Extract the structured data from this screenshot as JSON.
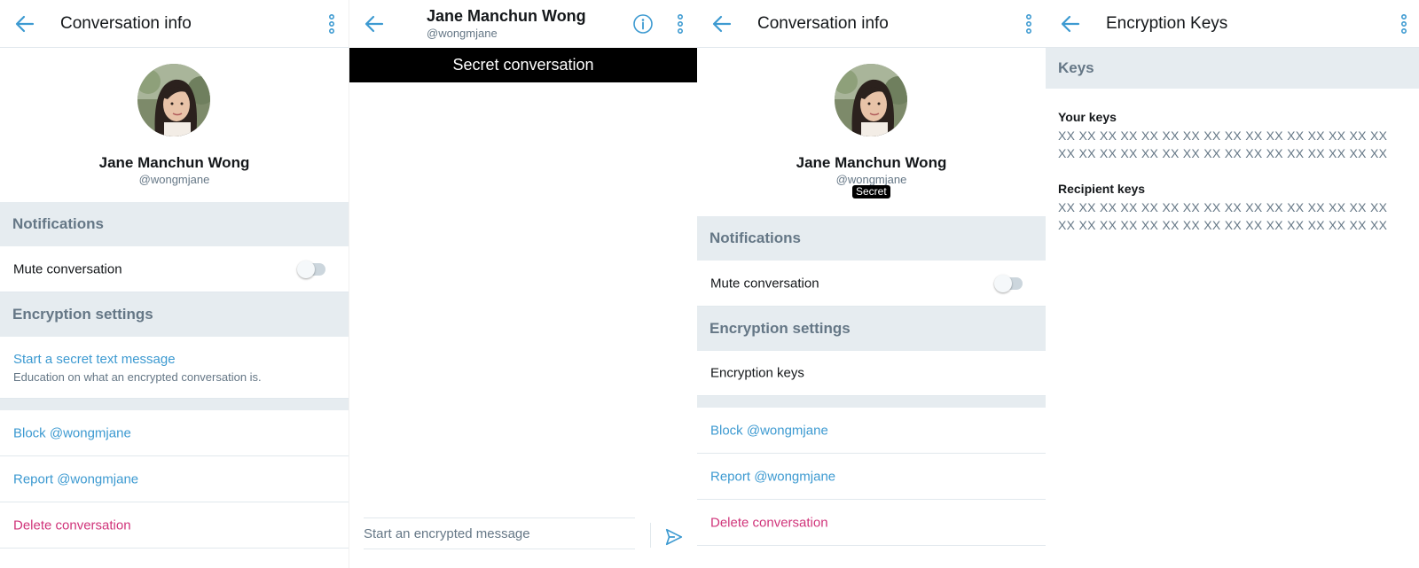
{
  "colors": {
    "accent": "#3d9ad1",
    "danger": "#d0347a",
    "section_bg": "#e6ecf0",
    "secret_bar": "#000000"
  },
  "panel1": {
    "header_title": "Conversation info",
    "profile": {
      "name": "Jane Manchun Wong",
      "handle": "@wongmjane"
    },
    "notifications_section": "Notifications",
    "mute_label": "Mute conversation",
    "encryption_section": "Encryption settings",
    "secret_message_label": "Start a secret text message",
    "secret_message_sub": "Education on what an encrypted conversation is.",
    "block_label": "Block @wongmjane",
    "report_label": "Report @wongmjane",
    "delete_label": "Delete conversation"
  },
  "panel2": {
    "header_name": "Jane Manchun Wong",
    "header_handle": "@wongmjane",
    "secret_bar": "Secret conversation",
    "compose_placeholder": "Start an encrypted message"
  },
  "panel3": {
    "header_title": "Conversation info",
    "profile": {
      "name": "Jane Manchun Wong",
      "handle": "@wongmjane",
      "badge": "Secret"
    },
    "notifications_section": "Notifications",
    "mute_label": "Mute conversation",
    "encryption_section": "Encryption settings",
    "encryption_keys_label": "Encryption keys",
    "block_label": "Block @wongmjane",
    "report_label": "Report @wongmjane",
    "delete_label": "Delete conversation"
  },
  "panel4": {
    "header_title": "Encryption Keys",
    "keys_section": "Keys",
    "your_keys_label": "Your keys",
    "your_keys_line1": "XX XX XX XX XX XX XX XX XX XX XX XX XX XX XX XX",
    "your_keys_line2": "XX XX XX XX XX XX XX XX XX XX XX XX XX XX XX XX",
    "recipient_keys_label": "Recipient keys",
    "recipient_keys_line1": "XX XX XX XX XX XX XX XX XX XX XX XX XX XX XX XX",
    "recipient_keys_line2": "XX XX XX XX XX XX XX XX XX XX XX XX XX XX XX XX"
  },
  "icons": [
    "back-arrow-icon",
    "more-vertical-icon",
    "info-icon",
    "send-icon",
    "toggle-switch"
  ]
}
